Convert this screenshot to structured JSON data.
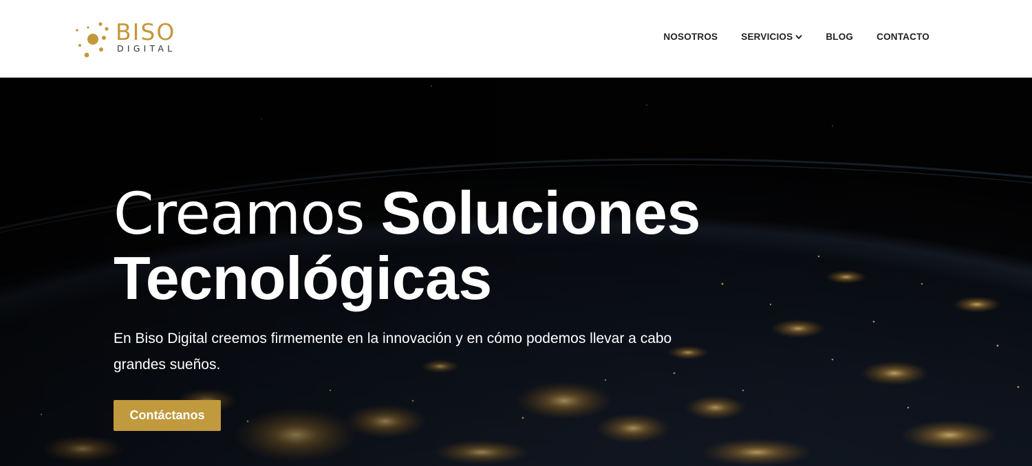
{
  "brand": {
    "name": "BISO",
    "subname": "DIGITAL",
    "primary_color": "#c3983a"
  },
  "nav": {
    "items": [
      {
        "label": "NOSOTROS",
        "has_dropdown": false
      },
      {
        "label": "SERVICIOS",
        "has_dropdown": true
      },
      {
        "label": "BLOG",
        "has_dropdown": false
      },
      {
        "label": "CONTACTO",
        "has_dropdown": false
      }
    ]
  },
  "hero": {
    "title_light": "Creamos",
    "title_bold_1": "Soluciones",
    "title_bold_2": "Tecnológicas",
    "description": "En Biso Digital creemos firmemente en la innovación y en cómo podemos llevar a cabo grandes sueños.",
    "cta_label": "Contáctanos",
    "cta_color": "#c19a3e",
    "background": "night-earth-from-space"
  }
}
